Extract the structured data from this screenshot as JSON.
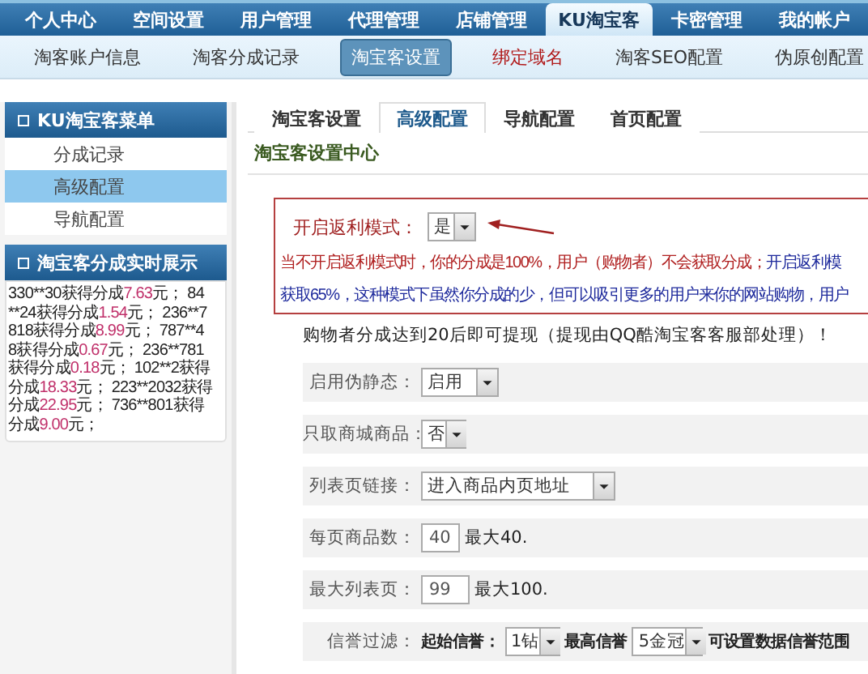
{
  "top_nav": [
    {
      "label": "个人中心",
      "selected": false
    },
    {
      "label": "空间设置",
      "selected": false
    },
    {
      "label": "用户管理",
      "selected": false
    },
    {
      "label": "代理管理",
      "selected": false
    },
    {
      "label": "店铺管理",
      "selected": false
    },
    {
      "label": "KU淘宝客",
      "selected": true
    },
    {
      "label": "卡密管理",
      "selected": false
    },
    {
      "label": "我的帐户",
      "selected": false
    }
  ],
  "sub_nav": [
    {
      "label": "淘客账户信息",
      "selected": false,
      "highlighted": false
    },
    {
      "label": "淘客分成记录",
      "selected": false,
      "highlighted": false
    },
    {
      "label": "淘宝客设置",
      "selected": true,
      "highlighted": false
    },
    {
      "label": "绑定域名",
      "selected": false,
      "highlighted": true
    },
    {
      "label": "淘客SEO配置",
      "selected": false,
      "highlighted": false
    },
    {
      "label": "伪原创配置",
      "selected": false,
      "highlighted": false
    }
  ],
  "sidebar": {
    "menu_title": "KU淘宝客菜单",
    "items": [
      {
        "label": "分成记录",
        "selected": false
      },
      {
        "label": "高级配置",
        "selected": true
      },
      {
        "label": "导航配置",
        "selected": false
      }
    ],
    "ticker_title": "淘宝客分成实时展示",
    "ticker_lines": [
      [
        {
          "kind": "text",
          "text": "330**30获得分成"
        },
        {
          "kind": "amount",
          "text": "7.63"
        },
        {
          "kind": "text",
          "text": "元； 84"
        }
      ],
      [
        {
          "kind": "text",
          "text": "**24获得分成"
        },
        {
          "kind": "amount",
          "text": "1.54"
        },
        {
          "kind": "text",
          "text": "元； 236**7"
        }
      ],
      [
        {
          "kind": "text",
          "text": "818获得分成"
        },
        {
          "kind": "amount",
          "text": "8.99"
        },
        {
          "kind": "text",
          "text": "元； 787**4"
        }
      ],
      [
        {
          "kind": "text",
          "text": "8获得分成"
        },
        {
          "kind": "amount",
          "text": "0.67"
        },
        {
          "kind": "text",
          "text": "元； 236**781"
        }
      ],
      [
        {
          "kind": "text",
          "text": "获得分成"
        },
        {
          "kind": "amount",
          "text": "0.18"
        },
        {
          "kind": "text",
          "text": "元； 102**2获得"
        }
      ],
      [
        {
          "kind": "text",
          "text": "分成"
        },
        {
          "kind": "amount",
          "text": "18.33"
        },
        {
          "kind": "text",
          "text": "元； 223**2032获得"
        }
      ],
      [
        {
          "kind": "text",
          "text": "分成"
        },
        {
          "kind": "amount",
          "text": "22.95"
        },
        {
          "kind": "text",
          "text": "元； 736**801获得"
        }
      ],
      [
        {
          "kind": "text",
          "text": "分成"
        },
        {
          "kind": "amount",
          "text": "9.00"
        },
        {
          "kind": "text",
          "text": "元；"
        }
      ]
    ]
  },
  "tabs": [
    {
      "label": "淘宝客设置",
      "selected": false
    },
    {
      "label": "高级配置",
      "selected": true
    },
    {
      "label": "导航配置",
      "selected": false
    },
    {
      "label": "首页配置",
      "selected": false
    }
  ],
  "panel_title": "淘宝客设置中心",
  "rebate": {
    "label": "开启返利模式：",
    "value": "是",
    "warning": "当不开启返利模式时，你的分成是100%，用户（购物者）不会获取分成；",
    "info_start": "开启返利模",
    "info_line": "获取65%，这种模式下虽然你分成的少，但可以吸引更多的用户来你的网站购物，用户"
  },
  "withdraw_note": "购物者分成达到20后即可提现（提现由QQ酷淘宝客客服部处理）！",
  "rows": [
    {
      "kind": "select",
      "label": "启用伪静态：",
      "value": "启用"
    },
    {
      "kind": "select",
      "label": "只取商城商品：",
      "value": "否"
    },
    {
      "kind": "select",
      "label": "列表页链接：",
      "value": "进入商品内页地址"
    },
    {
      "kind": "input",
      "label": "每页商品数：",
      "value": "40",
      "hint": "最大40."
    },
    {
      "kind": "input",
      "label": "最大列表页：",
      "value": "99",
      "hint": "最大100."
    },
    {
      "kind": "range",
      "label": "信誉过滤：",
      "from_label": "起始信誉：",
      "from": "1钻",
      "to_label": "最高信誉",
      "to": "5金冠",
      "hint": "可设置数据信誉范围"
    }
  ]
}
